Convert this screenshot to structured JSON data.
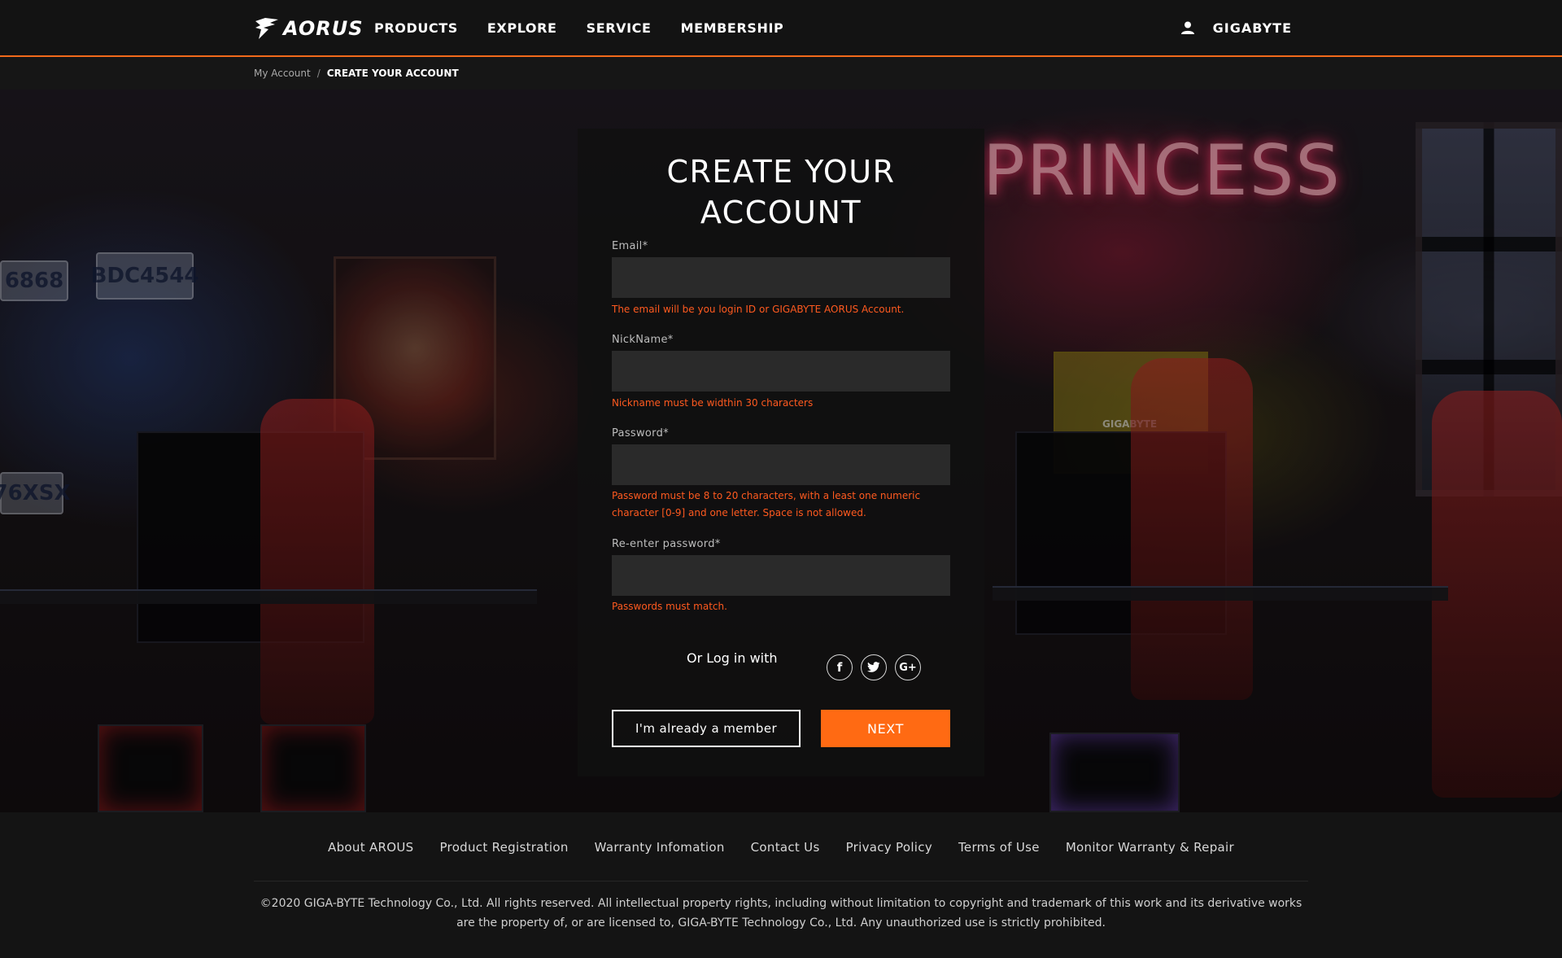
{
  "header": {
    "logo_text": "AORUS",
    "nav": [
      {
        "label": "PRODUCTS"
      },
      {
        "label": "EXPLORE"
      },
      {
        "label": "SERVICE"
      },
      {
        "label": "MEMBERSHIP"
      }
    ],
    "user_icon": "user-icon",
    "brand": "GIGABYTE"
  },
  "breadcrumb": {
    "parent": "My Account",
    "separator": "/",
    "current": "CREATE YOUR ACCOUNT"
  },
  "form": {
    "title_line1": "CREATE YOUR",
    "title_line2": "ACCOUNT",
    "email": {
      "label": "Email*",
      "value": "",
      "hint": "The email will be you login ID or GIGABYTE AORUS Account."
    },
    "nickname": {
      "label": "NickName*",
      "value": "",
      "hint": "Nickname must be widthin 30 characters"
    },
    "password": {
      "label": "Password*",
      "value": "",
      "hint": "Password must be 8 to 20 characters, with a least one numeric character [0-9] and one letter. Space is not allowed."
    },
    "repassword": {
      "label": "Re-enter password*",
      "value": "",
      "hint": "Passwords must match."
    },
    "social_label": "Or Log in with",
    "social": [
      {
        "icon": "facebook-icon",
        "glyph": "f"
      },
      {
        "icon": "twitter-icon",
        "glyph": "t"
      },
      {
        "icon": "google-plus-icon",
        "glyph": "G+"
      }
    ],
    "member_button": "I'm already a member",
    "next_button": "NEXT"
  },
  "background": {
    "neon_sign": "PRINCESS",
    "plates": [
      "6868",
      "BDC4544",
      "76XSX"
    ],
    "gigabyte_box": "GIGABYTE"
  },
  "footer": {
    "links": [
      "About AROUS",
      "Product Registration",
      "Warranty Infomation",
      "Contact Us",
      "Privacy Policy",
      "Terms of Use",
      "Monitor Warranty & Repair"
    ],
    "copyright": "©2020 GIGA-BYTE Technology Co., Ltd. All rights reserved. All intellectual property rights, including without limitation to copyright and trademark of this work and its derivative works are the property of, or are licensed to, GIGA-BYTE Technology Co., Ltd. Any unauthorized use is strictly prohibited."
  },
  "colors": {
    "accent": "#ff6a13",
    "error": "#ff5a1f",
    "header_border": "#f26a1b"
  }
}
